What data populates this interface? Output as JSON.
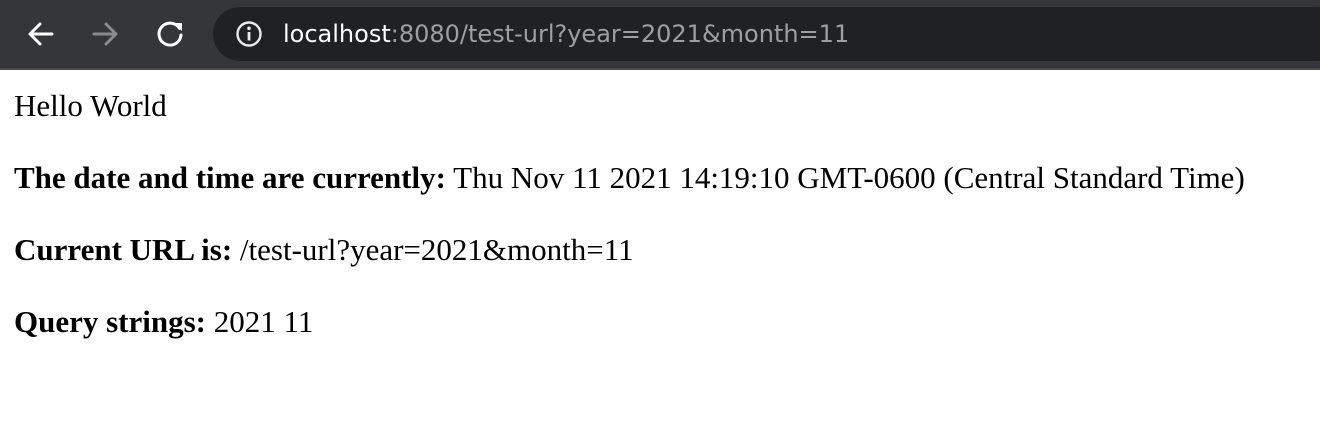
{
  "browser": {
    "nav": {
      "back_icon": "arrow-left-icon",
      "forward_icon": "arrow-right-icon",
      "reload_icon": "reload-icon"
    },
    "address_bar": {
      "info_icon": "info-icon",
      "host": "localhost",
      "rest": ":8080/test-url?year=2021&month=11"
    },
    "colors": {
      "toolbar_bg": "#35363a",
      "omnibox_bg": "#202124",
      "host_text": "#ffffff",
      "url_rest_text": "#9aa0a6",
      "forward_disabled": "#8a8b8e"
    }
  },
  "page": {
    "greeting": "Hello World",
    "date_label": "The date and time are currently:",
    "date_value": "Thu Nov 11 2021 14:19:10 GMT-0600 (Central Standard Time)",
    "url_label": "Current URL is:",
    "url_value": "/test-url?year=2021&month=11",
    "query_label": "Query strings:",
    "query_value": "2021 11"
  }
}
